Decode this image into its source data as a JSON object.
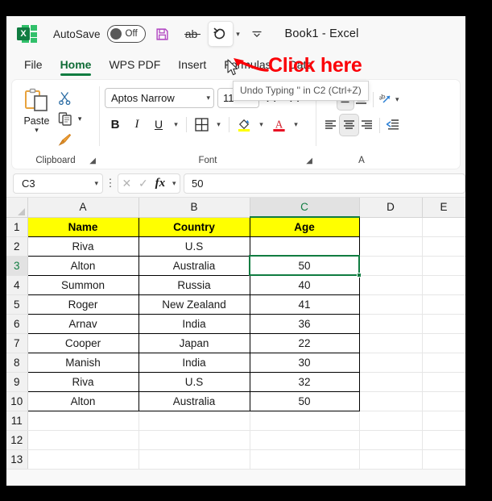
{
  "titlebar": {
    "app_icon": "excel-logo-icon",
    "autosave_label": "AutoSave",
    "autosave_state": "Off",
    "save_icon": "save-icon",
    "spelling_icon": "spelling-icon",
    "undo_icon": "undo-icon",
    "undo_dropdown_icon": "chevron-down-icon",
    "qat_customize_icon": "chevron-down-icon",
    "document_title": "Book1  -  Excel"
  },
  "annotation": {
    "text": "Click here",
    "color": "#fb0007"
  },
  "tooltip": {
    "text": "Undo Typing '' in C2 (Ctrl+Z)"
  },
  "tabs": [
    {
      "label": "File",
      "active": false
    },
    {
      "label": "Home",
      "active": true
    },
    {
      "label": "WPS PDF",
      "active": false
    },
    {
      "label": "Insert",
      "active": false
    },
    {
      "label": "Formulas",
      "active": false
    },
    {
      "label": "Data",
      "active": false
    }
  ],
  "ribbon": {
    "clipboard": {
      "group_label": "Clipboard",
      "paste_label": "Paste",
      "paste_icon": "paste-icon",
      "paste_chevron": "chevron-down-icon",
      "cut_icon": "scissors-icon",
      "copy_icon": "copy-icon",
      "copy_chevron": "chevron-down-icon",
      "format_painter_icon": "format-painter-icon",
      "launcher_icon": "dialog-launcher-icon"
    },
    "font": {
      "group_label": "Font",
      "font_name": "Aptos Narrow",
      "font_size": "11",
      "grow_font_label": "A",
      "shrink_font_label": "A",
      "bold_label": "B",
      "italic_label": "I",
      "underline_label": "U",
      "underline_chevron": "chevron-down-icon",
      "borders_icon": "borders-icon",
      "borders_chevron": "chevron-down-icon",
      "fill_color_icon": "fill-color-icon",
      "fill_color_value": "#ffff00",
      "fill_chevron": "chevron-down-icon",
      "font_color_icon": "font-color-icon",
      "font_color_value": "#e81123",
      "font_color_chevron": "chevron-down-icon",
      "launcher_icon": "dialog-launcher-icon"
    },
    "alignment": {
      "group_label": "A",
      "align_top_icon": "align-top-icon",
      "align_middle_icon": "align-middle-icon",
      "align_bottom_icon": "align-bottom-icon",
      "wrap_text_icon": "wrap-text-icon",
      "wrap_chevron": "chevron-down-icon",
      "align_left_icon": "align-left-icon",
      "align_center_icon": "align-center-icon",
      "align_right_icon": "align-right-icon",
      "decrease_indent_icon": "decrease-indent-icon"
    }
  },
  "formula_bar": {
    "name_box": "C3",
    "name_box_chevron": "chevron-down-icon",
    "menu_icon": "vertical-dots-icon",
    "cancel_icon": "cancel-x-icon",
    "enter_icon": "enter-check-icon",
    "fx_label": "fx",
    "fx_chevron": "chevron-down-icon",
    "formula_value": "50"
  },
  "grid": {
    "columns": [
      "A",
      "B",
      "C",
      "D",
      "E"
    ],
    "selected_column": "C",
    "selected_row": 3,
    "selected_cell": "C3",
    "rows": [
      {
        "num": "1",
        "cells": [
          "Name",
          "Country",
          "Age"
        ],
        "header": true
      },
      {
        "num": "2",
        "cells": [
          "Riva",
          "U.S",
          ""
        ],
        "header": false
      },
      {
        "num": "3",
        "cells": [
          "Alton",
          "Australia",
          "50"
        ],
        "header": false
      },
      {
        "num": "4",
        "cells": [
          "Summon",
          "Russia",
          "40"
        ],
        "header": false
      },
      {
        "num": "5",
        "cells": [
          "Roger",
          "New Zealand",
          "41"
        ],
        "header": false
      },
      {
        "num": "6",
        "cells": [
          "Arnav",
          "India",
          "36"
        ],
        "header": false
      },
      {
        "num": "7",
        "cells": [
          "Cooper",
          "Japan",
          "22"
        ],
        "header": false
      },
      {
        "num": "8",
        "cells": [
          "Manish",
          "India",
          "30"
        ],
        "header": false
      },
      {
        "num": "9",
        "cells": [
          "Riva",
          "U.S",
          "32"
        ],
        "header": false
      },
      {
        "num": "10",
        "cells": [
          "Alton",
          "Australia",
          "50"
        ],
        "header": false
      },
      {
        "num": "11",
        "cells": [
          "",
          "",
          ""
        ],
        "header": false
      },
      {
        "num": "12",
        "cells": [
          "",
          "",
          ""
        ],
        "header": false
      },
      {
        "num": "13",
        "cells": [
          "",
          "",
          ""
        ],
        "header": false
      }
    ]
  }
}
